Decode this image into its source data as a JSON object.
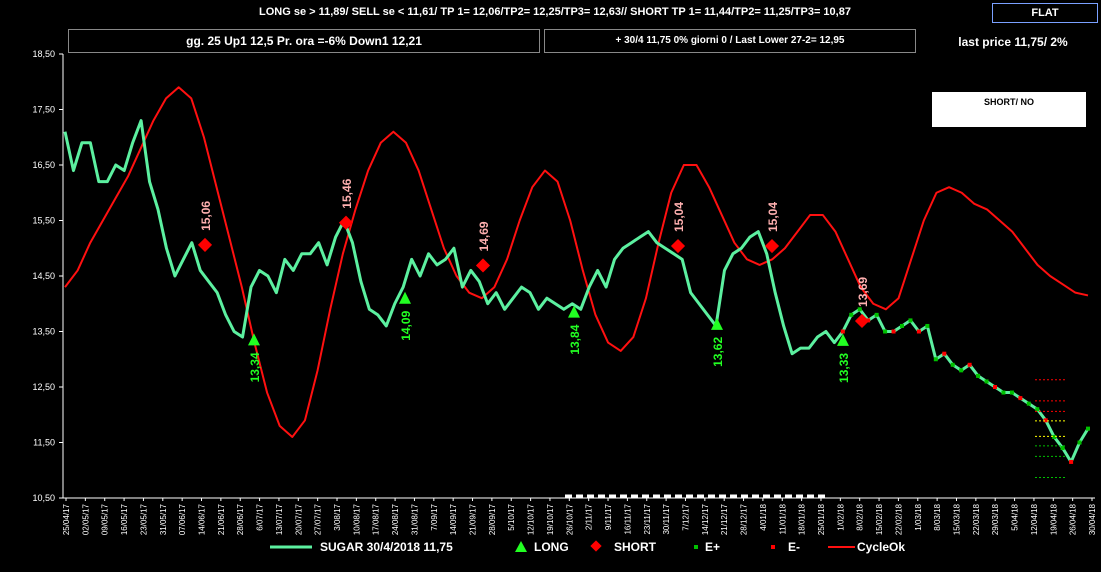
{
  "header": {
    "top_line": "LONG se > 11,89/  SELL se < 11,61/ TP 1= 12,06/TP2= 12,25/TP3= 12,63//   SHORT TP 1= 11,44/TP2= 11,25/TP3= 10,87",
    "flat_label": "FLAT",
    "info_left": "gg. 25 Up1  12,5  Pr. ora =-6%   Down1 12,21",
    "info_mid": "+ 30/4   11,75  0%  giorni 0 / Last Lower 27-2= 12,95",
    "last_price": "last price 11,75/  2%",
    "signal_box": "SHORT/ NO"
  },
  "legend": {
    "sugar": "SUGAR    30/4/2018    11,75",
    "long": "LONG",
    "short": "SHORT",
    "eplus": "E+",
    "eminus": "E-",
    "cycle": "CycleOk"
  },
  "colors": {
    "sugar": "#5cf0a0",
    "cycle": "#ff1010",
    "long": "#22ff22",
    "short": "#ff0000",
    "eplus": "#00c000",
    "eminus": "#ff0000",
    "background": "#000000",
    "axis": "#ffffff"
  },
  "chart_data": {
    "type": "line",
    "ylim": [
      10.5,
      18.5
    ],
    "yticks": [
      "18,50",
      "17,50",
      "16,50",
      "15,50",
      "14,50",
      "13,50",
      "12,50",
      "11,50",
      "10,50"
    ],
    "xlabels": [
      "25/04/17",
      "02/05/17",
      "09/05/17",
      "16/05/17",
      "23/05/17",
      "31/05/17",
      "07/06/17",
      "14/06/17",
      "21/06/17",
      "28/06/17",
      "6/07/17",
      "13/07/17",
      "20/07/17",
      "27/07/17",
      "3/08/17",
      "10/08/17",
      "17/08/17",
      "24/08/17",
      "31/08/17",
      "7/09/17",
      "14/09/17",
      "21/09/17",
      "28/09/17",
      "5/10/17",
      "12/10/17",
      "19/10/17",
      "26/10/17",
      "2/11/17",
      "9/11/17",
      "16/11/17",
      "23/11/17",
      "30/11/17",
      "7/12/17",
      "14/12/17",
      "21/12/17",
      "28/12/17",
      "4/01/18",
      "11/01/18",
      "18/01/18",
      "25/01/18",
      "1/02/18",
      "8/02/18",
      "15/02/18",
      "22/02/18",
      "1/03/18",
      "8/03/18",
      "15/03/18",
      "22/03/18",
      "29/03/18",
      "5/04/18",
      "12/04/18",
      "19/04/18",
      "26/04/18",
      "30/04/18"
    ],
    "series": [
      {
        "name": "SUGAR",
        "values": [
          17.1,
          16.4,
          16.9,
          16.9,
          16.2,
          16.2,
          16.5,
          16.4,
          16.9,
          17.3,
          16.2,
          15.7,
          15.0,
          14.5,
          14.8,
          15.1,
          14.6,
          14.4,
          14.2,
          13.8,
          13.5,
          13.4,
          14.3,
          14.6,
          14.5,
          14.2,
          14.8,
          14.6,
          14.9,
          14.9,
          15.1,
          14.7,
          15.2,
          15.5,
          15.1,
          14.4,
          13.9,
          13.8,
          13.6,
          14.0,
          14.3,
          14.8,
          14.5,
          14.9,
          14.7,
          14.8,
          15.0,
          14.3,
          14.6,
          14.4,
          14.0,
          14.2,
          13.9,
          14.1,
          14.3,
          14.2,
          13.9,
          14.1,
          14.0,
          13.9,
          14.0,
          13.9,
          14.3,
          14.6,
          14.3,
          14.8,
          15.0,
          15.1,
          15.2,
          15.3,
          15.1,
          15.0,
          14.9,
          14.8,
          14.2,
          14.0,
          13.8,
          13.6,
          14.6,
          14.9,
          15.0,
          15.2,
          15.3,
          14.9,
          14.2,
          13.6,
          13.1,
          13.2,
          13.2,
          13.4,
          13.5,
          13.3,
          13.5,
          13.8,
          13.9,
          13.7,
          13.8,
          13.5,
          13.5,
          13.6,
          13.7,
          13.5,
          13.6,
          13.0,
          13.1,
          12.9,
          12.8,
          12.9,
          12.7,
          12.6,
          12.5,
          12.4,
          12.4,
          12.3,
          12.2,
          12.1,
          11.9,
          11.6,
          11.4,
          11.15,
          11.5,
          11.75
        ]
      },
      {
        "name": "CycleOk",
        "values": [
          14.3,
          14.6,
          15.1,
          15.5,
          15.9,
          16.3,
          16.8,
          17.3,
          17.7,
          17.9,
          17.7,
          17.0,
          16.1,
          15.2,
          14.3,
          13.3,
          12.4,
          11.8,
          11.6,
          11.9,
          12.8,
          13.9,
          14.9,
          15.7,
          16.4,
          16.9,
          17.1,
          16.9,
          16.4,
          15.7,
          15.0,
          14.5,
          14.2,
          14.1,
          14.3,
          14.8,
          15.5,
          16.1,
          16.4,
          16.2,
          15.5,
          14.6,
          13.8,
          13.3,
          13.15,
          13.4,
          14.1,
          15.1,
          16.0,
          16.5,
          16.5,
          16.1,
          15.6,
          15.1,
          14.8,
          14.7,
          14.8,
          15.0,
          15.3,
          15.6,
          15.6,
          15.3,
          14.8,
          14.3,
          14.0,
          13.9,
          14.1,
          14.8,
          15.5,
          16.0,
          16.1,
          16.0,
          15.8,
          15.7,
          15.5,
          15.3,
          15.0,
          14.7,
          14.5,
          14.35,
          14.2,
          14.15
        ]
      }
    ],
    "short_signals": [
      {
        "label": "15,06",
        "value": 15.06
      },
      {
        "label": "15,46",
        "value": 15.46
      },
      {
        "label": "14,69",
        "value": 14.69
      },
      {
        "label": "15,04",
        "value": 15.04
      },
      {
        "label": "15,04",
        "value": 15.04
      },
      {
        "label": "13,69",
        "value": 13.69
      }
    ],
    "long_signals": [
      {
        "label": "13,34",
        "value": 13.34
      },
      {
        "label": "14,09",
        "value": 14.09
      },
      {
        "label": "13,84",
        "value": 13.84
      },
      {
        "label": "13,62",
        "value": 13.62
      },
      {
        "label": "13,33",
        "value": 13.33
      }
    ],
    "levels": [
      12.63,
      12.25,
      12.06,
      11.89,
      11.61,
      11.44,
      11.25,
      10.87
    ]
  }
}
